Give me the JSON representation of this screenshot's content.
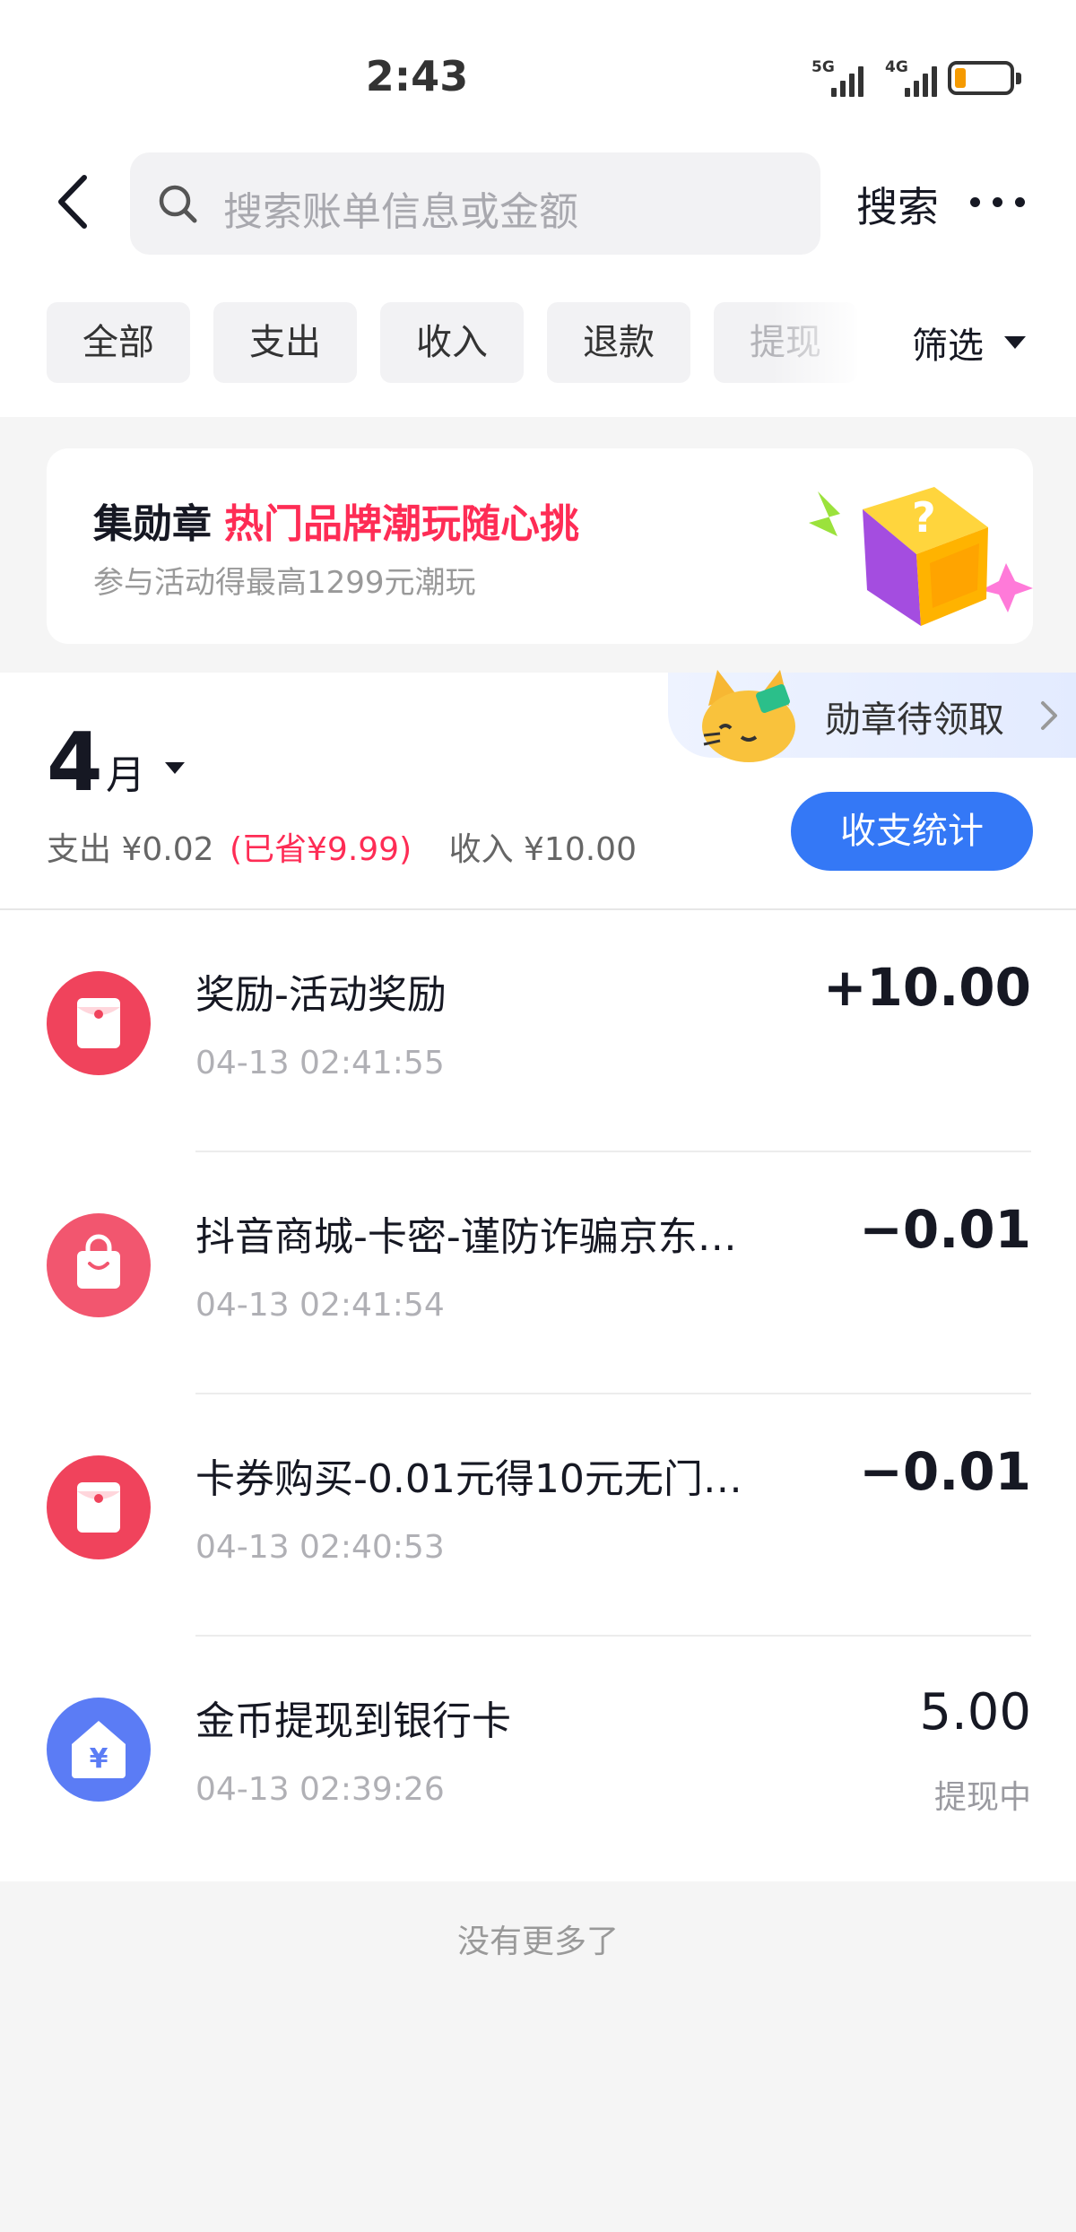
{
  "status_bar": {
    "time": "2:43",
    "signal_1": "5G",
    "signal_2": "4G"
  },
  "header": {
    "search_placeholder": "搜索账单信息或金额",
    "search_button": "搜索"
  },
  "filters": {
    "chips": [
      "全部",
      "支出",
      "收入",
      "退款",
      "提现"
    ],
    "filter_label": "筛选"
  },
  "banner": {
    "title": "集勋章",
    "highlight": "热门品牌潮玩随心挑",
    "subtitle": "参与活动得最高1299元潮玩"
  },
  "summary": {
    "month_number": "4",
    "month_unit": "月",
    "badge_label": "勋章待领取",
    "expense": "支出 ¥0.02",
    "saved": "(已省¥9.99)",
    "income": "收入 ¥10.00",
    "stats_button": "收支统计"
  },
  "transactions": [
    {
      "icon": "red-envelope-icon",
      "title": "奖励-活动奖励",
      "time": "04-13 02:41:55",
      "amount": "+10.00",
      "status": ""
    },
    {
      "icon": "shopping-bag-icon",
      "title": "抖音商城-卡密-谨防诈骗京东…",
      "time": "04-13 02:41:54",
      "amount": "−0.01",
      "status": ""
    },
    {
      "icon": "red-envelope-icon",
      "title": "卡券购买-0.01元得10元无门…",
      "time": "04-13 02:40:53",
      "amount": "−0.01",
      "status": ""
    },
    {
      "icon": "yuan-house-icon",
      "title": "金币提现到银行卡",
      "time": "04-13 02:39:26",
      "amount": "5.00",
      "status": "提现中"
    }
  ],
  "footer": {
    "no_more": "没有更多了"
  },
  "colors": {
    "accent_blue": "#3478f6",
    "accent_red": "#fe2c55",
    "withdraw_icon": "#5b7cf5"
  }
}
